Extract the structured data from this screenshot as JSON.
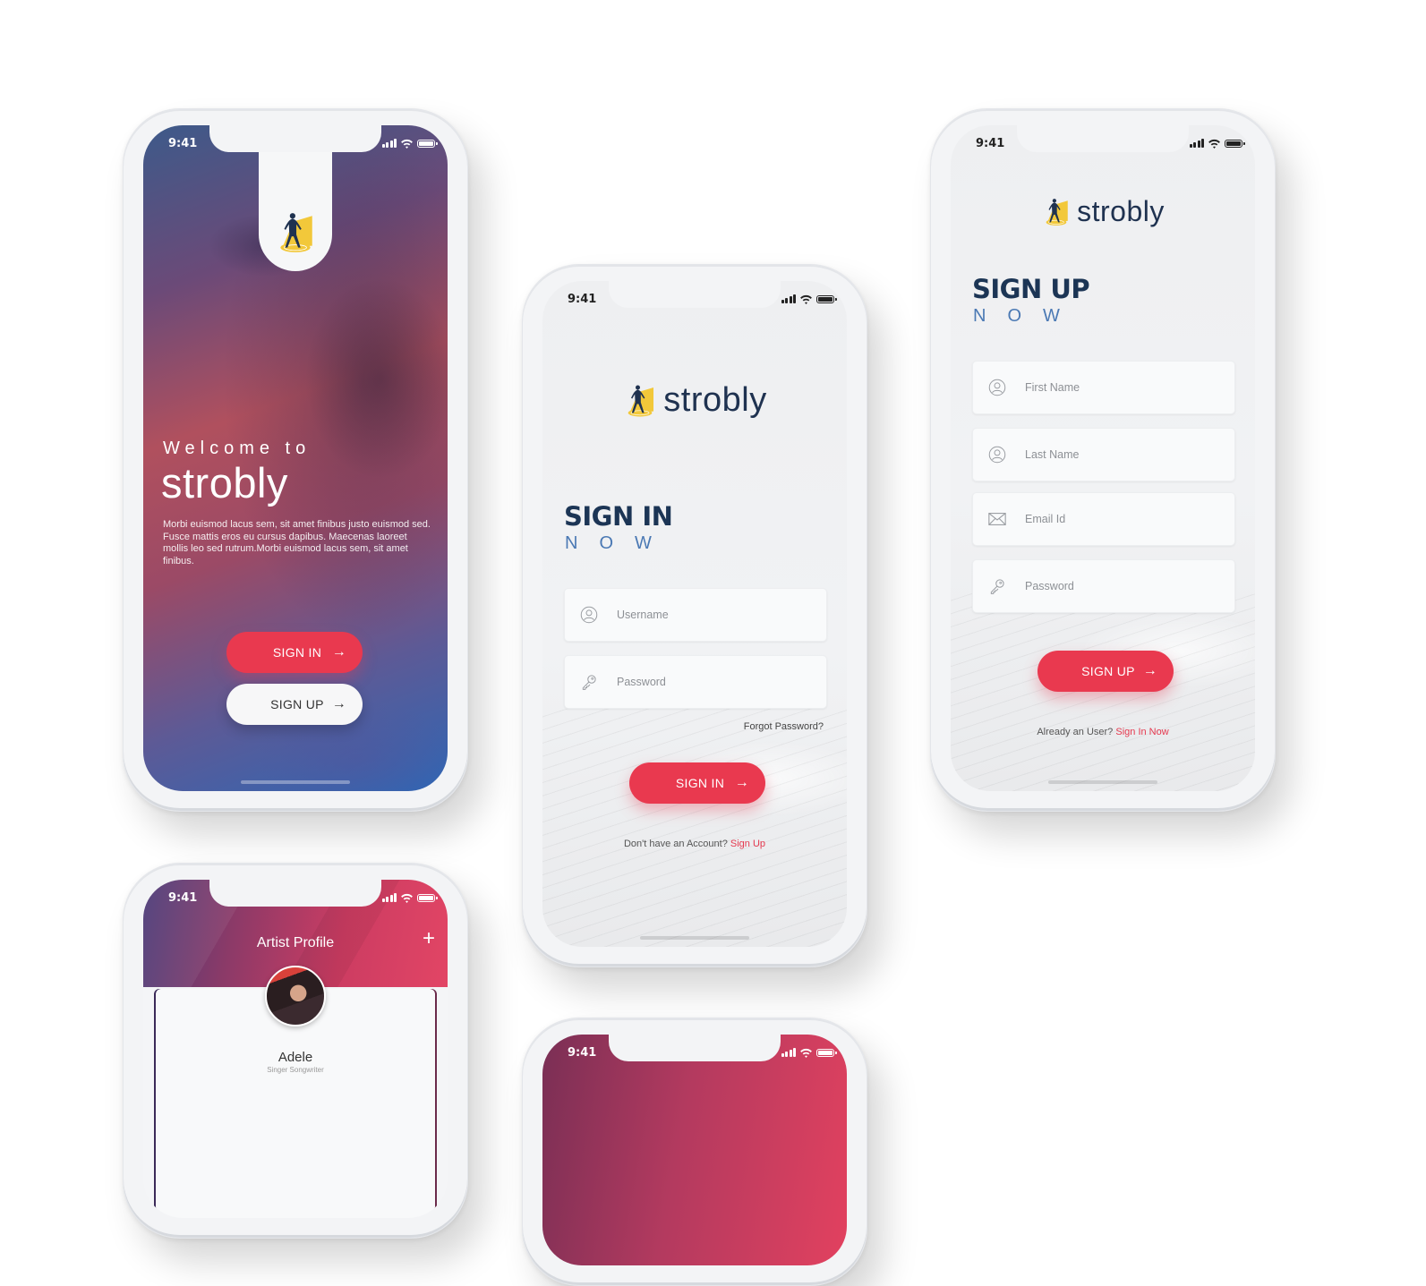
{
  "status_bar": {
    "time": "9:41"
  },
  "colors": {
    "accent": "#e9394f",
    "navy": "#1c3555",
    "blue": "#4b79b4",
    "logo_yellow": "#f2c83a"
  },
  "brand": {
    "name": "strobly",
    "logo_icon": "spotlight-figure-icon"
  },
  "welcome_screen": {
    "welcome_text": "Welcome to",
    "brand": "strobly",
    "description": "Morbi euismod lacus sem, sit amet finibus justo euismod sed. Fusce mattis eros eu cursus dapibus. Maecenas laoreet mollis leo sed rutrum.Morbi euismod lacus sem, sit amet finibus.",
    "sign_in_label": "SIGN IN",
    "sign_up_label": "SIGN UP",
    "arrow_icon": "→"
  },
  "sign_in_screen": {
    "heading": "SIGN IN",
    "subheading": "NOW",
    "fields": [
      {
        "placeholder": "Username",
        "icon": "user-icon"
      },
      {
        "placeholder": "Password",
        "icon": "key-icon"
      }
    ],
    "forgot_password": "Forgot Password?",
    "button_label": "SIGN IN",
    "footer_text": "Don't have an Account?",
    "footer_link": "Sign Up"
  },
  "sign_up_screen": {
    "heading": "SIGN UP",
    "subheading": "NOW",
    "fields": [
      {
        "placeholder": "First Name",
        "icon": "user-icon"
      },
      {
        "placeholder": "Last Name",
        "icon": "user-icon"
      },
      {
        "placeholder": "Email Id",
        "icon": "mail-icon"
      },
      {
        "placeholder": "Password",
        "icon": "key-icon"
      }
    ],
    "button_label": "SIGN UP",
    "footer_text": "Already an User?",
    "footer_link": "Sign In Now"
  },
  "artist_profile_screen": {
    "title": "Artist Profile",
    "add_icon": "+",
    "artist_name": "Adele",
    "artist_role": "Singer Songwriter"
  }
}
